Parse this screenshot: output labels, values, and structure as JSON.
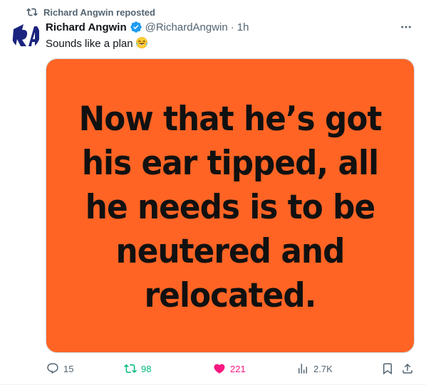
{
  "repost_banner": {
    "text": "Richard Angwin reposted",
    "icon": "repost-icon"
  },
  "author": {
    "display_name": "Richard Angwin",
    "handle": "@RichardAngwin",
    "separator": "·",
    "timestamp": "1h",
    "verified": true,
    "avatar_initials": "RA"
  },
  "tweet": {
    "text": "Sounds like a plan",
    "emoji": "face-with-tears-of-joy"
  },
  "media": {
    "background_color": "#ff6424",
    "lines": [
      "Now that he’s got",
      "his ear tipped, all",
      "he needs is to be",
      "neutered and",
      "relocated."
    ]
  },
  "actions": {
    "reply_count": "15",
    "repost_count": "98",
    "like_count": "221",
    "view_count": "2.7K"
  },
  "colors": {
    "accent": "#1d9bf0",
    "repost_active": "#00ba7c",
    "like_active": "#f91880",
    "secondary_text": "#536471",
    "primary_text": "#0f1419"
  }
}
